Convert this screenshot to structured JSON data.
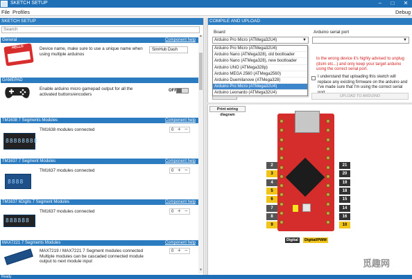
{
  "window": {
    "title": "SKETCH SETUP",
    "minimize": "–",
    "maximize": "□",
    "close": "✕"
  },
  "menu": {
    "file": "File",
    "profiles": "Profiles",
    "debug": "Debug"
  },
  "left": {
    "header": "SKETCH SETUP",
    "search_placeholder": "Search",
    "sections": {
      "general": {
        "title": "General",
        "help": "Component help",
        "desc": "Device name, make sure to use a unique name when using multiple arduinos",
        "value": "SimHub Dash",
        "image_text": "HELLO"
      },
      "gamepad": {
        "title": "GAMEPAD",
        "help": "Component help",
        "desc": "Enable arduino micro gamepad output for all the activated buttons/encoders",
        "toggle_label": "OFF"
      },
      "tm1638": {
        "title": "TM1638 7 Segments Modules",
        "help": "Component help",
        "desc": "TM1638 modules connected",
        "value": "0",
        "image_text": "88888888"
      },
      "tm1637": {
        "title": "TM1637 7 Segment Modules",
        "help": "Component help",
        "desc": "TM1637 modules connected",
        "value": "0",
        "image_text": "8888"
      },
      "tm1637_6": {
        "title": "TM1637 6Digits 7 Segment Modules",
        "help": "Component help",
        "desc": "TM1637 modules connected",
        "value": "0",
        "image_text": "888888"
      },
      "max7221": {
        "title": "MAX7221 7 Segments Modules",
        "help": "Component help",
        "desc": "MAX7219 / MAX7221 7 Segment modules connected\nMultiple modules can be cascaded connected module output to next module input",
        "value": "0"
      }
    }
  },
  "right": {
    "header": "COMPILE AND UPLOAD",
    "board_label": "Board",
    "board_value": "Arduino Pro Micro (ATMega32U4)",
    "serial_label": "Arduino serial port",
    "serial_value": "",
    "dropdown_options": [
      "Arduino Pro Micro (ATMega32U4)",
      "Arduino Nano (ATMega328), old bootloader",
      "Arduino Nano (ATMega328), new bootloader",
      "Arduino UNO (ATMega328p)",
      "Arduino MEGA 2560 (ATMega2560)",
      "Arduino Duemilanove (ATMega328)",
      "Arduino Pro Micro (ATMega32U4)",
      "Arduino Leonardo (ATMega32U4)"
    ],
    "dropdown_selected_index": 6,
    "warning": "to the wrong device it's highly advised to unplug (dsim etc...) and only keep your target arduino using the correct serial port.",
    "confirm": "I understand that uploading this sketch will replace any existing firmware on the arduino and I've made sure that I'm using the correct serial port.",
    "upload_button": "UPLOAD TO ARDUINO",
    "advanced_button": "ADVANCED",
    "print_button": "Print wiring diagram",
    "pins_left": [
      "2",
      "3",
      "4",
      "5",
      "6",
      "7",
      "8",
      "9"
    ],
    "pins_right": [
      "21",
      "20",
      "19",
      "18",
      "15",
      "14",
      "16",
      "10"
    ],
    "legend_digital": "Digital",
    "legend_pwm": "Digital/PWM",
    "colors": {
      "accent": "#2b7bc0",
      "board": "#d52c2c",
      "pin_yellow": "#f0c419",
      "warning": "#d22020"
    }
  },
  "status": {
    "text": "Ready"
  },
  "watermark": "觅趣网"
}
